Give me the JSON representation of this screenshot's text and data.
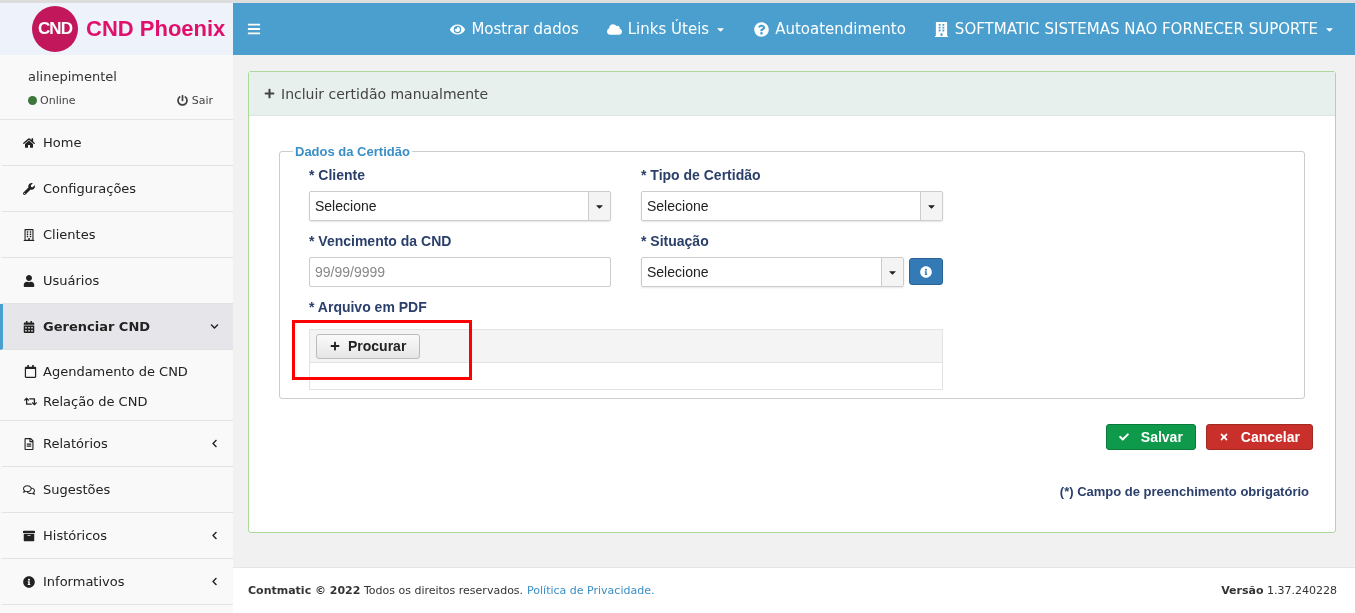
{
  "brand": {
    "logo_text": "CND",
    "name": "CND Phoenix"
  },
  "user": {
    "name": "alinepimentel",
    "status": "Online",
    "online": true,
    "logout": "Sair"
  },
  "sidebar": {
    "items": [
      {
        "label": "Home",
        "selected": false
      },
      {
        "label": "Configurações",
        "selected": false
      },
      {
        "label": "Clientes",
        "selected": false
      },
      {
        "label": "Usuários",
        "selected": false
      },
      {
        "label": "Gerenciar CND",
        "selected": true,
        "expanded": true,
        "children": [
          {
            "label": "Agendamento de CND"
          },
          {
            "label": "Relação de CND"
          }
        ]
      },
      {
        "label": "Relatórios",
        "selected": false,
        "expanded": false
      },
      {
        "label": "Sugestões",
        "selected": false
      },
      {
        "label": "Históricos",
        "selected": false,
        "expanded": false
      },
      {
        "label": "Informativos",
        "selected": false,
        "expanded": false
      }
    ]
  },
  "topbar": {
    "items": [
      {
        "label": "Mostrar dados",
        "dropdown": false
      },
      {
        "label": "Links Úteis",
        "dropdown": true
      },
      {
        "label": "Autoatendimento",
        "dropdown": false
      },
      {
        "label": "SOFTMATIC SISTEMAS NAO FORNECER SUPORTE",
        "dropdown": true
      }
    ]
  },
  "panel": {
    "title": "Incluir certidão manualmente",
    "fieldset": "Dados da Certidão",
    "fields": [
      {
        "kind": "select",
        "label": "* Cliente",
        "value": "Selecione"
      },
      {
        "kind": "select",
        "label": "* Tipo de Certidão",
        "value": "Selecione"
      },
      {
        "kind": "input",
        "label": "* Vencimento da CND",
        "placeholder": "99/99/9999"
      },
      {
        "kind": "select",
        "label": "* Situação",
        "value": "Selecione",
        "info": true
      }
    ],
    "file": {
      "label": "* Arquivo em PDF",
      "button": "Procurar",
      "highlighted": true
    },
    "buttons": [
      {
        "kind": "success",
        "label": "Salvar"
      },
      {
        "kind": "danger",
        "label": "Cancelar"
      }
    ],
    "note": "(*) Campo de preenchimento obrigatório"
  },
  "footer": {
    "text": "**Contmatic © 2022** Todos os direitos reservados.",
    "link": "Política de Privacidade.",
    "version": "**Versão** 1.37.240228"
  }
}
